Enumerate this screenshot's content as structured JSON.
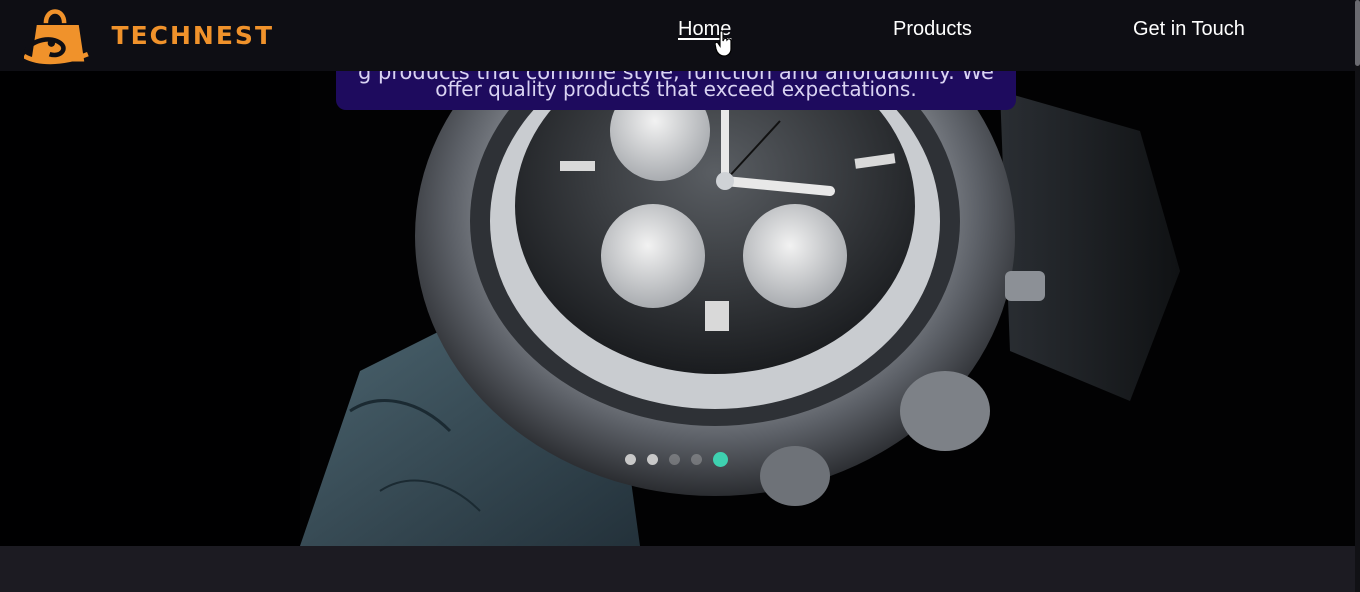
{
  "brand": {
    "name": "TECHNEST",
    "logo_icon": "shopping-bag-logo-icon"
  },
  "nav": {
    "items": [
      {
        "label": "Home",
        "active": true
      },
      {
        "label": "Products",
        "active": false
      },
      {
        "label": "Get in Touch",
        "active": false
      }
    ]
  },
  "hero": {
    "caption_partial": "g products that combine style, function and affordability. We",
    "caption": "offer quality products that exceed expectations.",
    "carousel": {
      "slide_count": 5,
      "active_index": 5
    }
  },
  "colors": {
    "nav_bg": "#0e0e14",
    "brand_orange": "#f0922b",
    "caption_bg": "#1e0b5e",
    "active_dot": "#3ed1b0",
    "page_bg": "#1c1b22"
  }
}
